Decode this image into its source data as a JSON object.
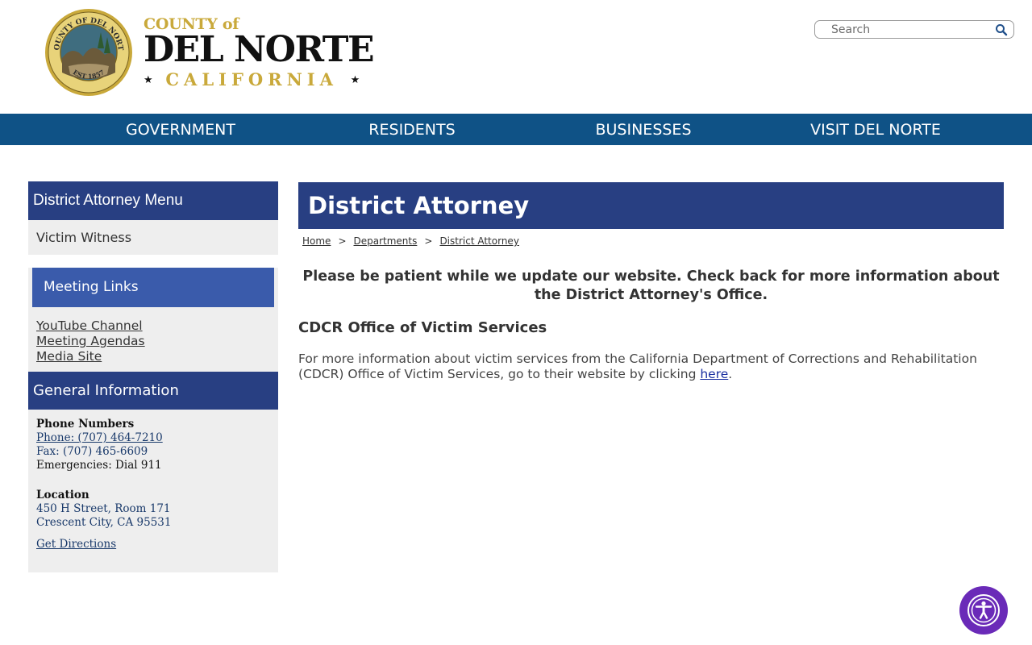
{
  "header": {
    "brand": {
      "county_of": "COUNTY of",
      "name": "DEL NORTE",
      "state": "CALIFORNIA",
      "seal_text_top": "COUNTY OF DEL NORTE",
      "seal_text_bottom": "EST 1857"
    },
    "search": {
      "placeholder": "Search",
      "value": ""
    }
  },
  "nav": {
    "items": [
      {
        "label": "GOVERNMENT"
      },
      {
        "label": "RESIDENTS"
      },
      {
        "label": "BUSINESSES"
      },
      {
        "label": "VISIT DEL NORTE"
      }
    ]
  },
  "sidebar": {
    "menu_title": "District Attorney Menu",
    "menu_items": [
      {
        "label": "Victim Witness"
      }
    ],
    "meeting": {
      "title": "Meeting Links",
      "links": [
        {
          "label": "YouTube Channel"
        },
        {
          "label": "Meeting Agendas"
        },
        {
          "label": "Media Site"
        }
      ]
    },
    "general": {
      "title": "General Information",
      "phone_label": "Phone Numbers",
      "phone": "Phone: (707) 464-7210",
      "fax": "Fax: (707) 465-6609",
      "emergencies": "Emergencies: Dial 911",
      "location_label": "Location",
      "address_line1": "450 H Street, Room 171",
      "address_line2": "Crescent City, CA 95531",
      "directions": "Get Directions"
    }
  },
  "main": {
    "title": "District Attorney",
    "breadcrumb": [
      {
        "label": "Home"
      },
      {
        "label": "Departments"
      },
      {
        "label": "District Attorney"
      }
    ],
    "breadcrumb_sep": ">",
    "notice": "Please be patient while we update our website.  Check back for more information about the District Attorney's Office.",
    "section_heading": "CDCR Office of Victim Services",
    "paragraph": "For more information about victim services from the California Department of Corrections and Rehabilitation (CDCR) Office of Victim Services, go to their website by clicking ",
    "paragraph_link": "here",
    "paragraph_end": "."
  },
  "icons": {
    "search": "search-icon",
    "accessibility": "accessibility-icon",
    "seal": "county-seal-logo"
  },
  "colors": {
    "nav_bg": "#0f5286",
    "heading_bg": "#283f82",
    "meeting_bg": "#3a5bab",
    "sidebar_bg": "#eeeeee",
    "brand_gold": "#c9a93b",
    "accessibility_bg": "#6a2ab8"
  }
}
